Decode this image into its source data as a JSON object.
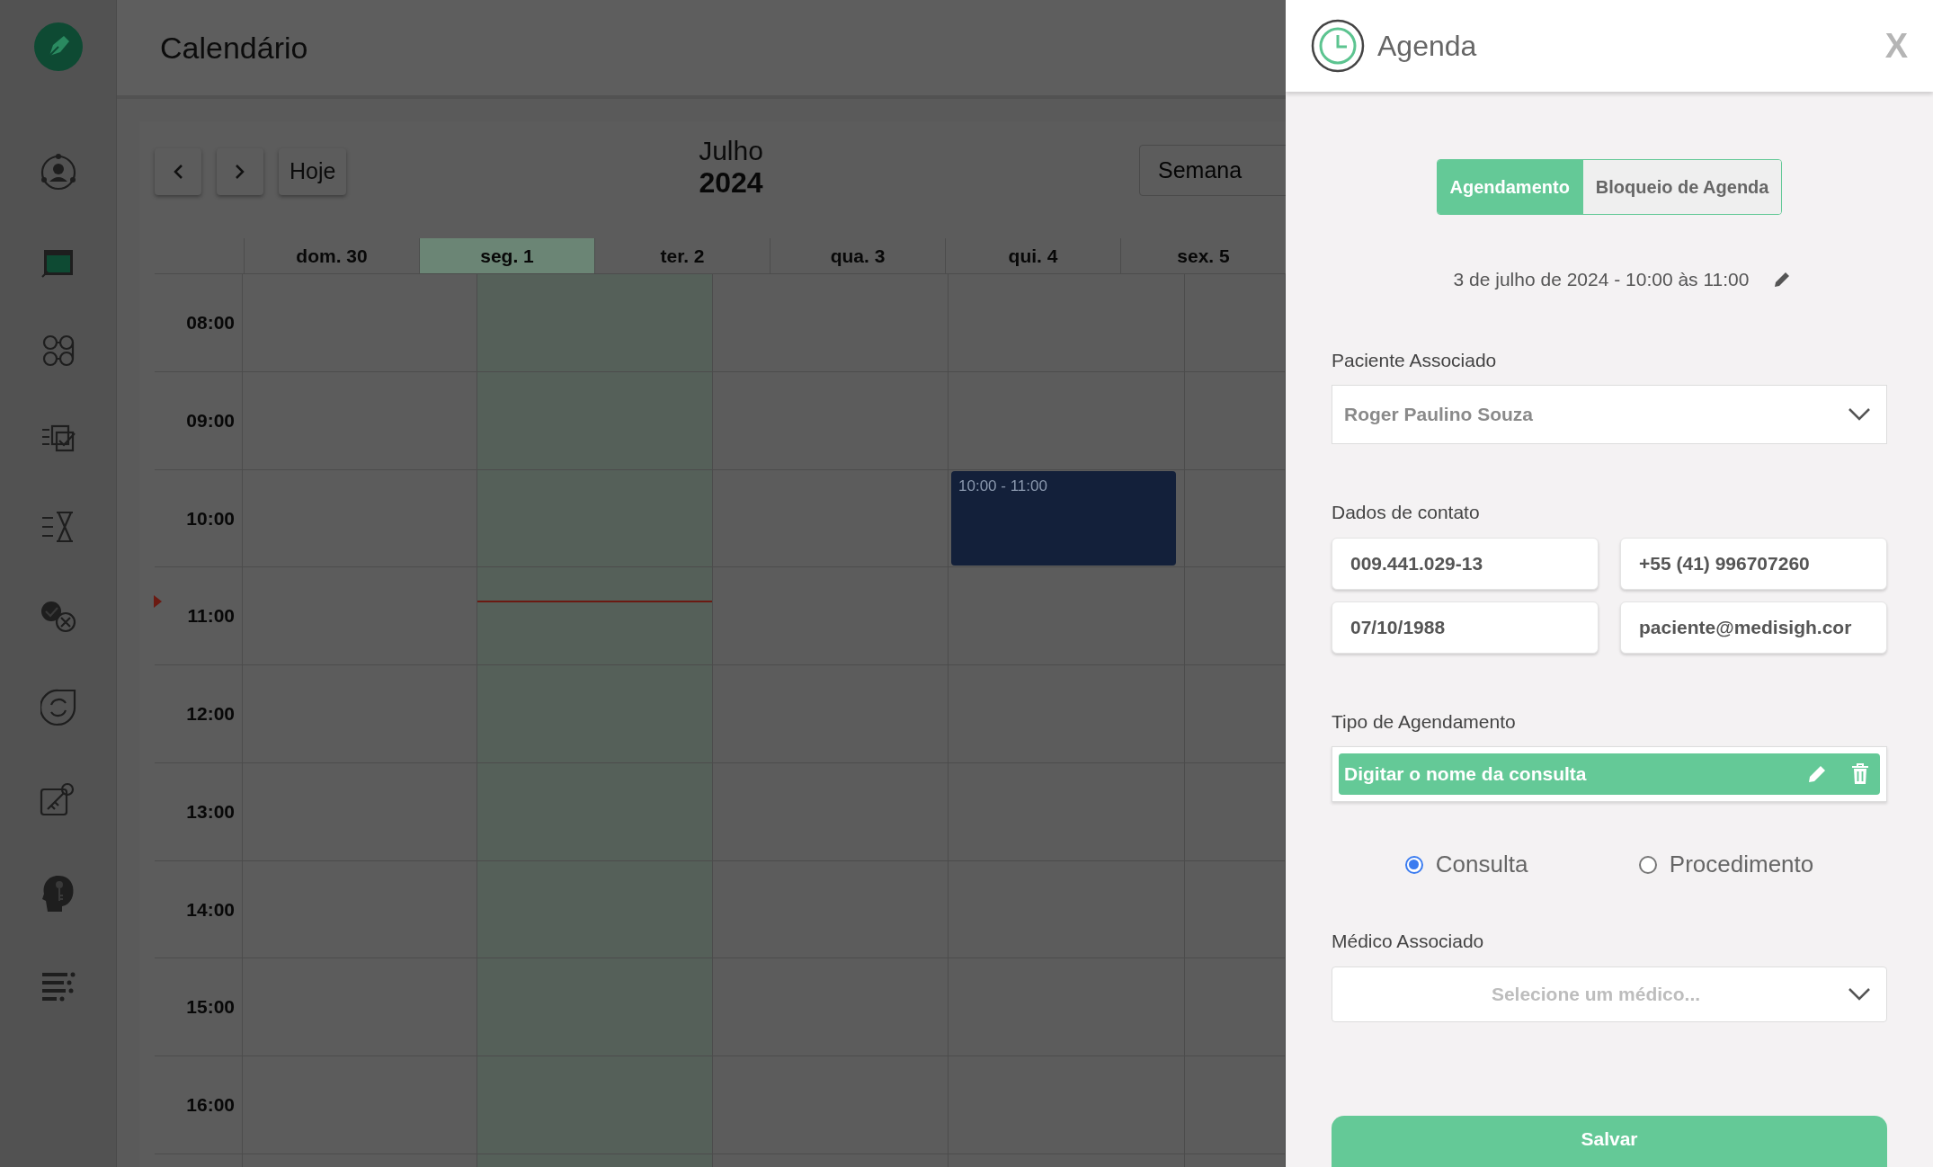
{
  "page_title": "Calendário",
  "calendar": {
    "nav": [
      {
        "kind": "prev"
      },
      {
        "kind": "next"
      },
      {
        "kind": "text",
        "label": "Hoje"
      }
    ],
    "month": "Julho",
    "year": "2024",
    "view": "Semana",
    "days": [
      {
        "label": "dom. 30",
        "selected": false
      },
      {
        "label": "seg. 1",
        "selected": true,
        "now_line": true
      },
      {
        "label": "ter. 2",
        "selected": false
      },
      {
        "label": "qua. 3",
        "selected": false,
        "events": [
          {
            "time": "10:00 - 11:00"
          }
        ]
      },
      {
        "label": "qui. 4",
        "selected": false
      },
      {
        "label": "sex. 5",
        "selected": false
      }
    ],
    "hours": [
      "08:00",
      "09:00",
      "10:00",
      "11:00",
      "12:00",
      "13:00",
      "14:00",
      "15:00",
      "16:00"
    ]
  },
  "panel": {
    "title": "Agenda",
    "close": "X",
    "tabs": [
      {
        "label": "Agendamento",
        "selected": true
      },
      {
        "label": "Bloqueio de Agenda",
        "selected": false
      }
    ],
    "datetime": "3 de julho de 2024 - 10:00 às 11:00",
    "patient": {
      "label": "Paciente Associado",
      "value": "Roger Paulino Souza"
    },
    "contact": {
      "label": "Dados de contato",
      "fields": [
        "009.441.029-13",
        "+55 (41) 996707260",
        "07/10/1988",
        "paciente@medisigh.cor"
      ]
    },
    "type": {
      "label": "Tipo de Agendamento",
      "tag": "Digitar o nome da consulta"
    },
    "radios": [
      {
        "label": "Consulta",
        "selected": true
      },
      {
        "label": "Procedimento",
        "selected": false
      }
    ],
    "doctor": {
      "label": "Médico Associado",
      "placeholder": "Selecione um médico..."
    },
    "save": "Salvar"
  }
}
